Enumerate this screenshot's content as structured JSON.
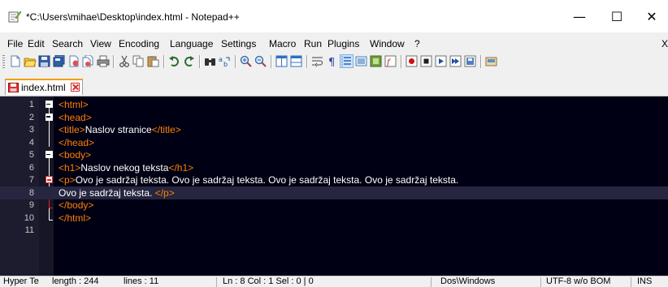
{
  "window": {
    "title": "*C:\\Users\\mihae\\Desktop\\index.html - Notepad++",
    "minimize": "—",
    "maximize": "☐",
    "close": "✕"
  },
  "menu": {
    "items": [
      "File",
      "Edit",
      "Search",
      "View",
      "Encoding",
      "Language",
      "Settings",
      "Macro",
      "Run",
      "Plugins",
      "Window",
      "?"
    ],
    "close_doc": "X"
  },
  "tabs": [
    {
      "label": "index.html",
      "active": true,
      "modified": true
    }
  ],
  "editor": {
    "lines": [
      {
        "num": "1",
        "parts": [
          [
            "tag",
            "<html>"
          ]
        ]
      },
      {
        "num": "2",
        "parts": [
          [
            "tag",
            "<head>"
          ]
        ]
      },
      {
        "num": "3",
        "parts": [
          [
            "tag",
            "<title>"
          ],
          [
            "txt",
            "Naslov stranice"
          ],
          [
            "tag",
            "</title>"
          ]
        ]
      },
      {
        "num": "4",
        "parts": [
          [
            "tag",
            "</head>"
          ]
        ]
      },
      {
        "num": "5",
        "parts": [
          [
            "tag",
            "<body>"
          ]
        ]
      },
      {
        "num": "6",
        "parts": [
          [
            "tag",
            "<h1>"
          ],
          [
            "txt",
            "Naslov nekog teksta"
          ],
          [
            "tag",
            "</h1>"
          ]
        ]
      },
      {
        "num": "7",
        "parts": [
          [
            "tag",
            "<p>"
          ],
          [
            "txt",
            "Ovo je sadržaj teksta. Ovo je sadržaj teksta. Ovo je sadržaj teksta. Ovo je sadržaj teksta."
          ]
        ]
      },
      {
        "num": "8",
        "parts": [
          [
            "txt",
            "Ovo je sadržaj teksta. "
          ],
          [
            "tag",
            "</p>"
          ]
        ]
      },
      {
        "num": "9",
        "parts": [
          [
            "tag",
            "</body>"
          ]
        ]
      },
      {
        "num": "10",
        "parts": [
          [
            "tag",
            "</html>"
          ]
        ]
      },
      {
        "num": "11",
        "parts": []
      }
    ],
    "current_line": 8
  },
  "status": {
    "doc_type": "Hyper Te",
    "length": "length : 244",
    "lines": "lines : 11",
    "position": "Ln : 8    Col : 1    Sel : 0 | 0",
    "eol": "Dos\\Windows",
    "encoding": "UTF-8 w/o BOM",
    "mode": "INS"
  },
  "colors": {
    "tag": "#ff8000",
    "text": "#ffffff",
    "editor_bg": "#000014",
    "tab_accent": "#f0a000"
  }
}
